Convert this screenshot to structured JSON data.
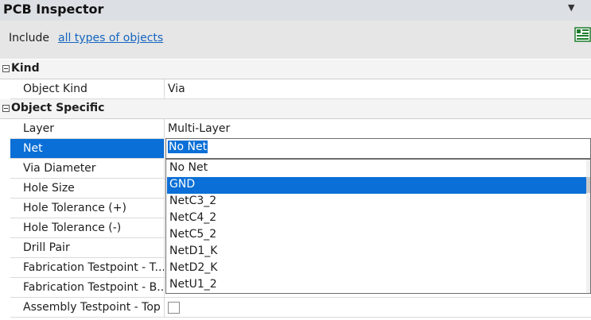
{
  "panel": {
    "title": "PCB Inspector"
  },
  "include": {
    "label": "Include",
    "link": "all types of objects"
  },
  "sections": {
    "kind": {
      "label": "Kind"
    },
    "specific": {
      "label": "Object Specific"
    }
  },
  "kind_rows": [
    {
      "name": "Object Kind",
      "value": "Via"
    }
  ],
  "specific_rows": [
    {
      "name": "Layer",
      "value": "Multi-Layer"
    },
    {
      "name": "Net",
      "value": "No Net"
    },
    {
      "name": "Via Diameter",
      "value": ""
    },
    {
      "name": "Hole Size",
      "value": ""
    },
    {
      "name": "Hole Tolerance (+)",
      "value": ""
    },
    {
      "name": "Hole Tolerance (-)",
      "value": ""
    },
    {
      "name": "Drill Pair",
      "value": ""
    },
    {
      "name": "Fabrication Testpoint - T...",
      "value": ""
    },
    {
      "name": "Fabrication Testpoint - B...",
      "value": ""
    },
    {
      "name": "Assembly Testpoint - Top",
      "value": ""
    }
  ],
  "net_dropdown": {
    "options": [
      "No Net",
      "GND",
      "NetC3_2",
      "NetC4_2",
      "NetC5_2",
      "NetD1_K",
      "NetD2_K",
      "NetU1_2"
    ],
    "highlighted": "GND"
  },
  "colors": {
    "selection": "#0a6fd6",
    "link": "#1565c0"
  }
}
